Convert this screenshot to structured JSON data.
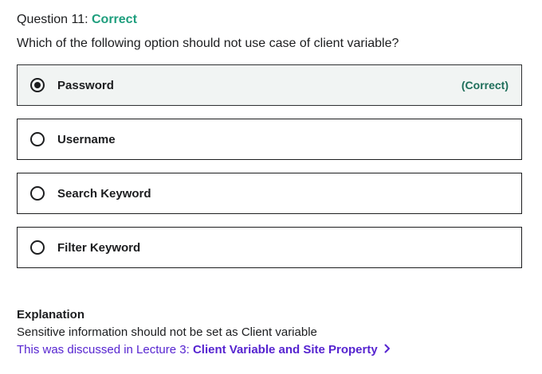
{
  "question": {
    "prefix": "Question 11:",
    "status": "Correct",
    "text": "Which of the following option should not use case of client variable?"
  },
  "options": [
    {
      "label": "Password",
      "tag": "(Correct)",
      "selected": true
    },
    {
      "label": "Username",
      "tag": "",
      "selected": false
    },
    {
      "label": "Search Keyword",
      "tag": "",
      "selected": false
    },
    {
      "label": "Filter Keyword",
      "tag": "",
      "selected": false
    }
  ],
  "explanation": {
    "title": "Explanation",
    "body": "Sensitive information should not be set as Client variable",
    "link_prefix": "This was discussed in Lecture 3:",
    "link_name": "Client Variable and Site Property",
    "link_icon": "chevron-right-icon"
  },
  "colors": {
    "correct": "#1e9e7d",
    "link": "#5624d0",
    "selected_bg": "#f1f4f3"
  }
}
